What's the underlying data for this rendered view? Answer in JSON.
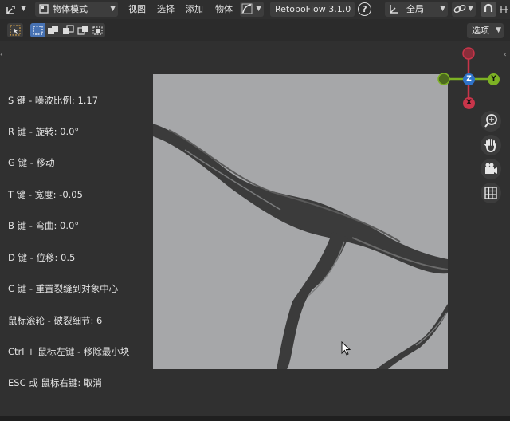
{
  "header": {
    "mode_label": "物体模式",
    "menus": [
      "视图",
      "选择",
      "添加",
      "物体"
    ],
    "addon_label": "RetopoFlow 3.1.0",
    "help_icon": "?",
    "transform_label": "全局"
  },
  "toolbar": {
    "options_label": "选项"
  },
  "gizmo": {
    "z": "Z",
    "y": "Y",
    "x": "X"
  },
  "help_lines": [
    "S 键 - 噪波比例:  1.17",
    "R 键 - 旋转:  0.0°",
    "G 键 - 移动",
    "T 键 - 宽度:  -0.05",
    "B 键 - 弯曲:  0.0°",
    "D 键 - 位移:  0.5",
    "C 键 - 重置裂缝到对象中心",
    "鼠标滚轮 - 破裂细节:  6",
    "Ctrl + 鼠标左键 - 移除最小块",
    "ESC 或 鼠标右键: 取消"
  ],
  "colors": {
    "gizmo_x": "#c8354a",
    "gizmo_y": "#7db224",
    "gizmo_z": "#2f73c9",
    "canvas_bg": "#a6a7a9",
    "crack": "#3a3a3a"
  }
}
